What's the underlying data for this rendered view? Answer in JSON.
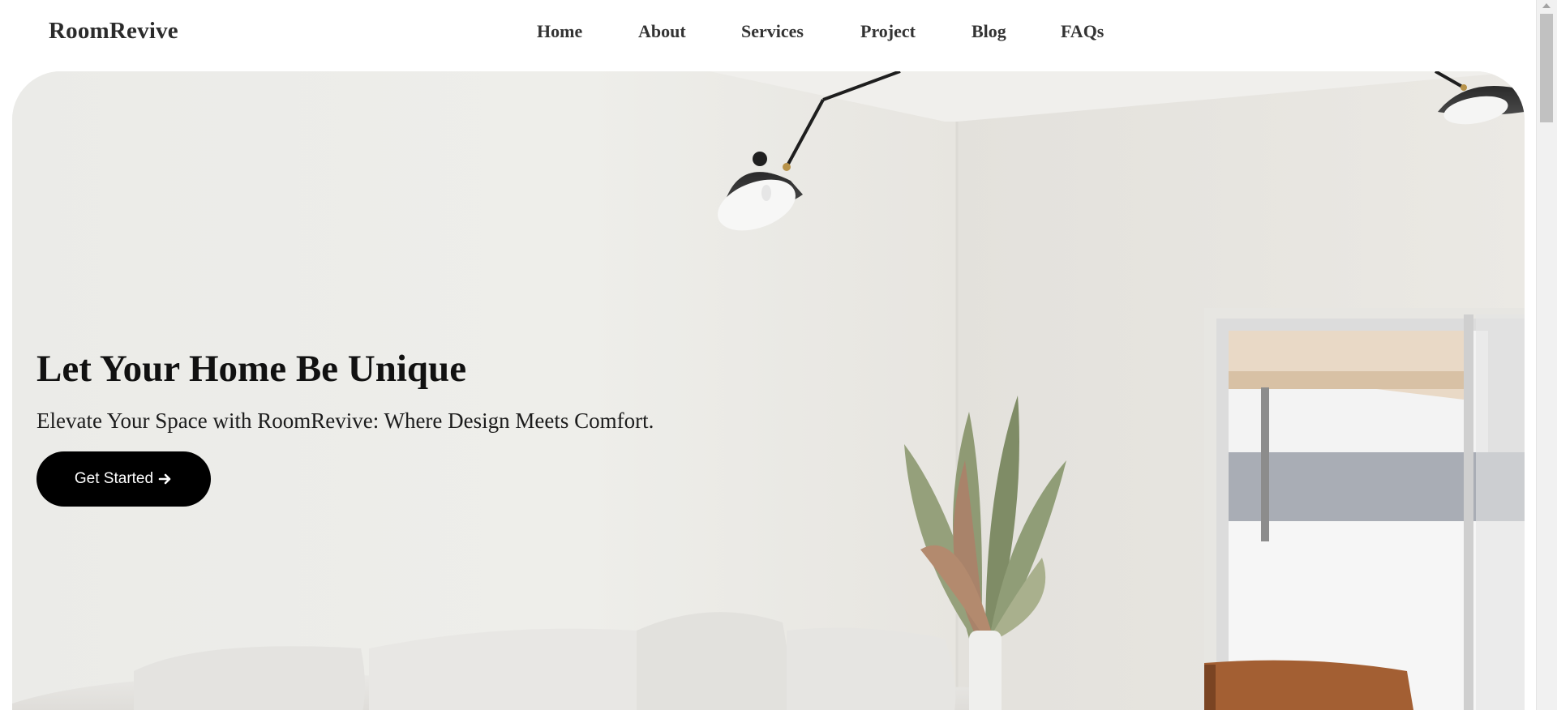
{
  "brand": {
    "name": "RoomRevive"
  },
  "nav": {
    "items": [
      {
        "label": "Home"
      },
      {
        "label": "About"
      },
      {
        "label": "Services"
      },
      {
        "label": "Project"
      },
      {
        "label": "Blog"
      },
      {
        "label": "FAQs"
      }
    ]
  },
  "hero": {
    "title": "Let Your Home Be Unique",
    "subtitle": "Elevate Your Space with RoomRevive: Where Design Meets Comfort.",
    "cta_label": "Get Started",
    "cta_icon": "arrow-right-icon",
    "image": "living-room-photo"
  },
  "colors": {
    "cta_background": "#000000",
    "cta_text": "#ffffff",
    "heading": "#111111",
    "nav_text": "#333333"
  }
}
